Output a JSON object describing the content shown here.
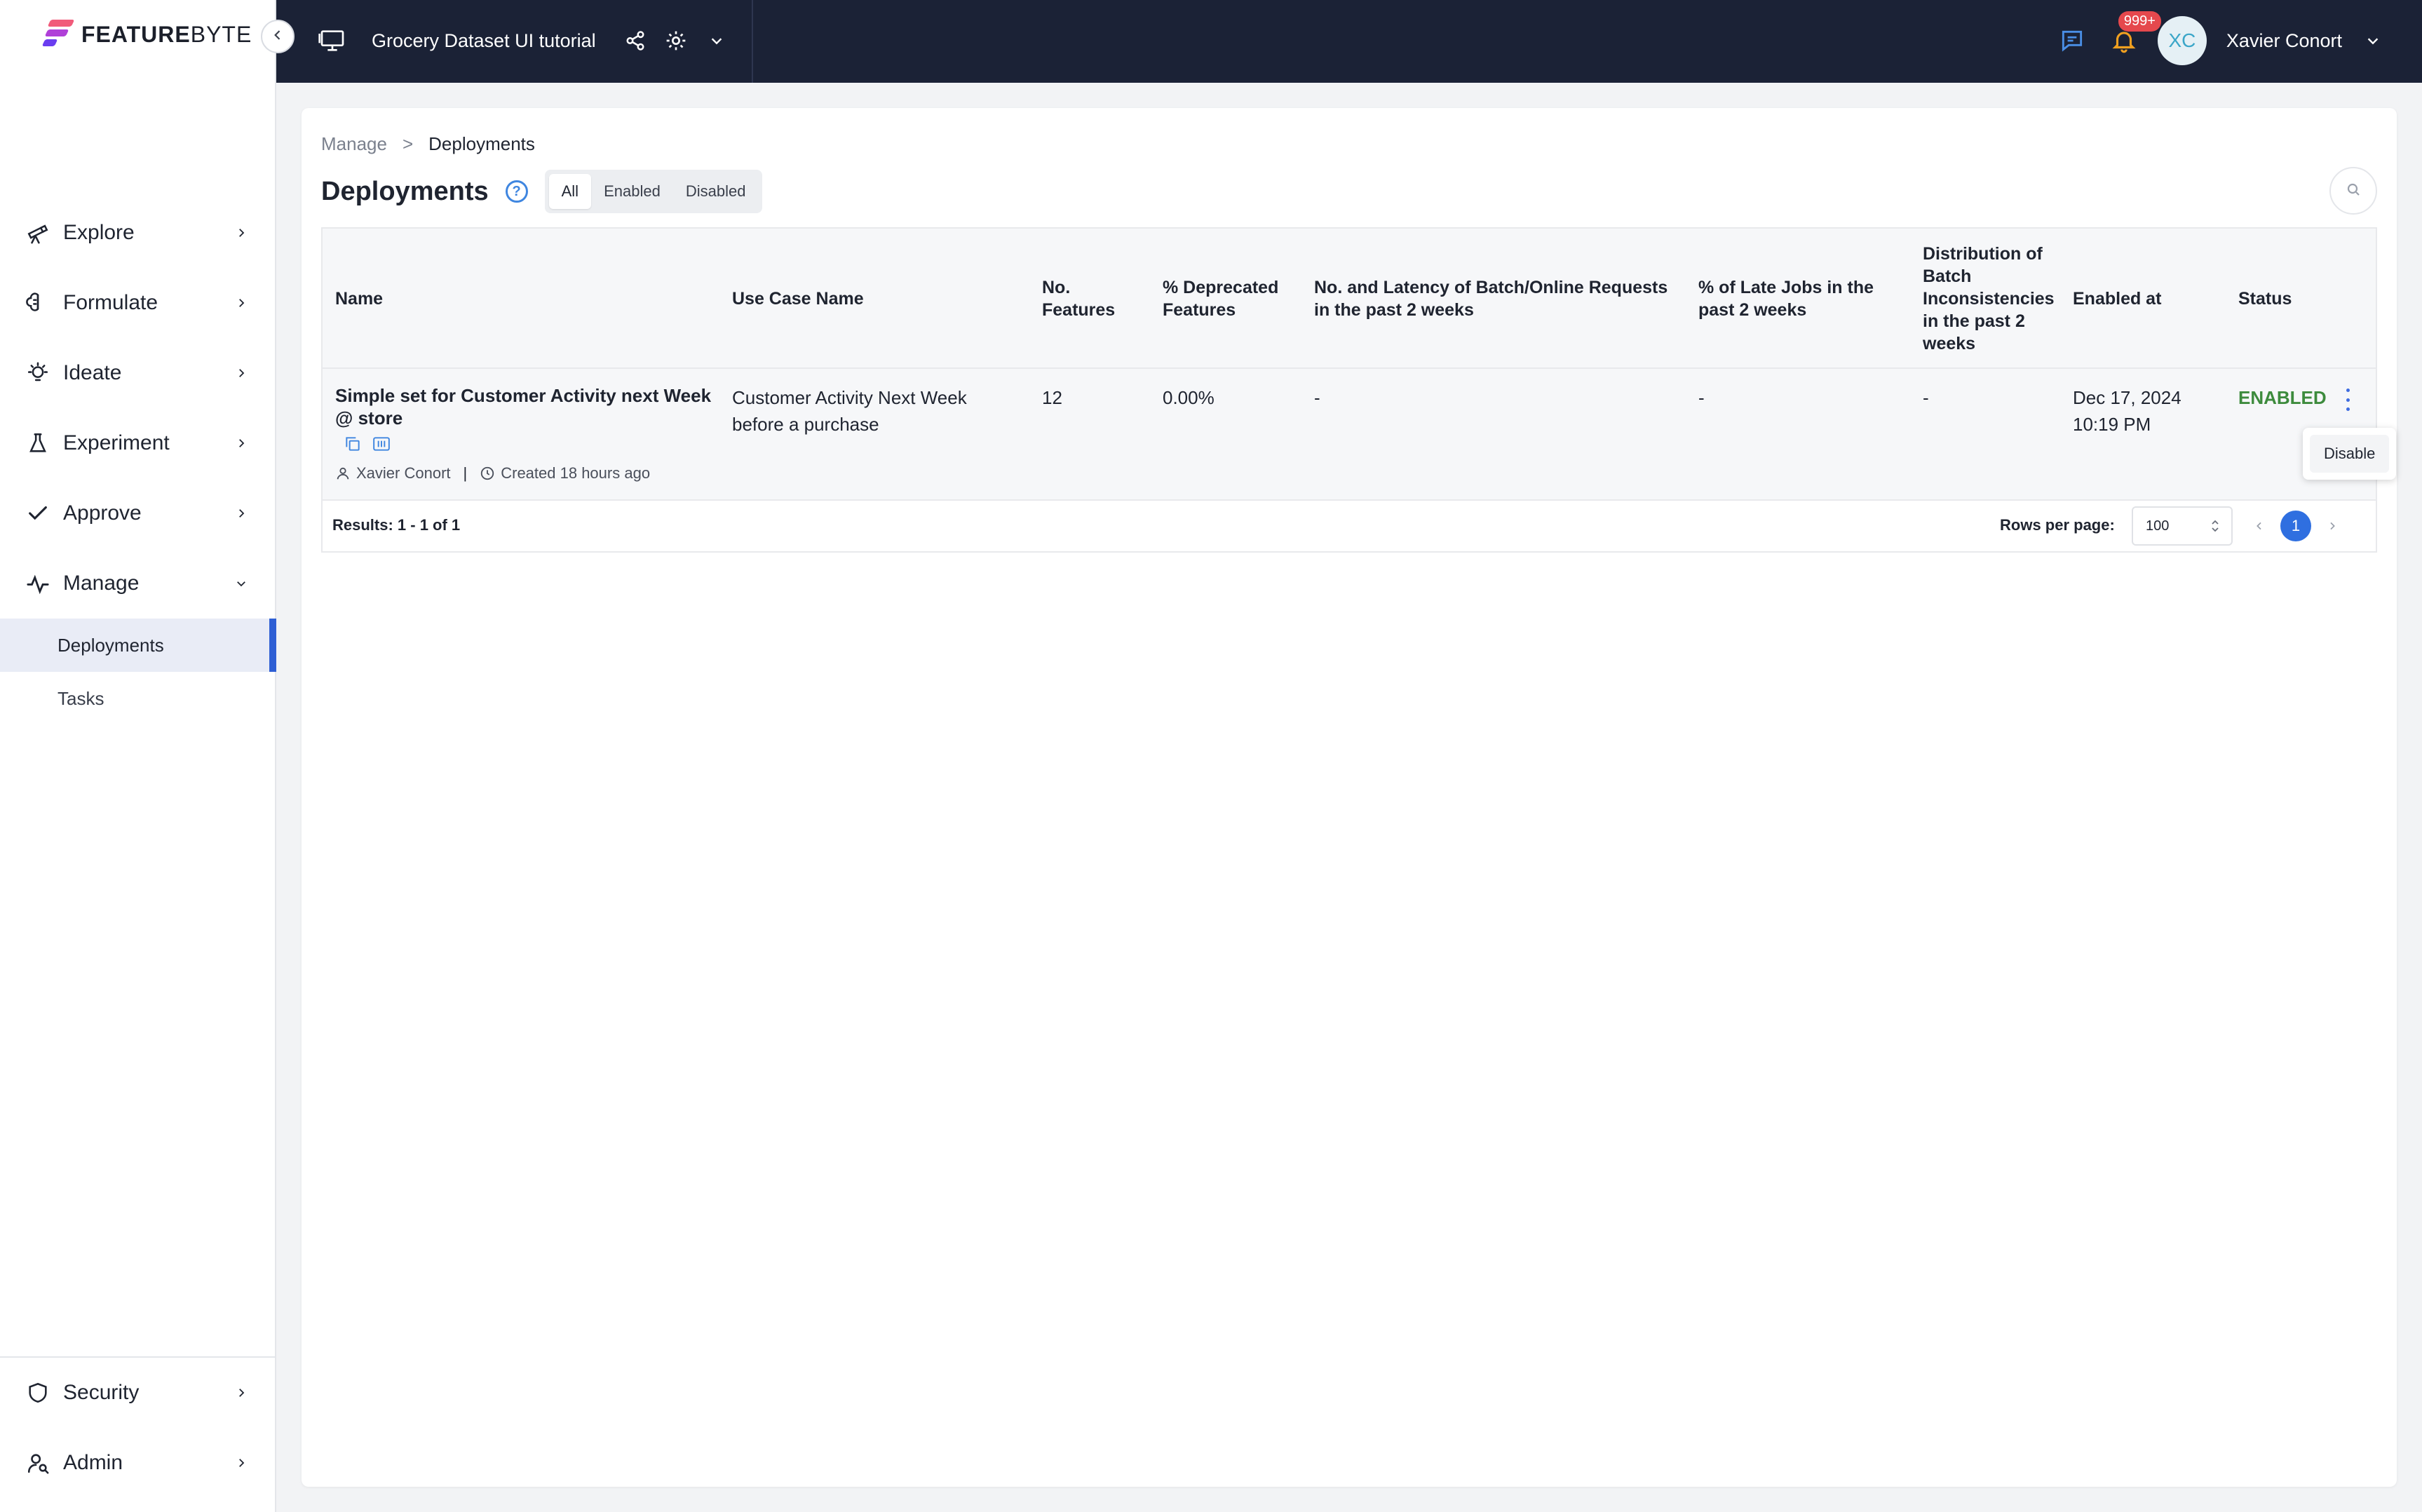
{
  "brand": {
    "word_bold": "FEATURE",
    "word_light": "BYTE"
  },
  "header": {
    "project_name": "Grocery Dataset UI tutorial",
    "notification_count": "999+",
    "avatar_initials": "XC",
    "user_name": "Xavier Conort"
  },
  "sidebar": {
    "items": [
      {
        "label": "Explore",
        "icon": "telescope-icon"
      },
      {
        "label": "Formulate",
        "icon": "brain-icon"
      },
      {
        "label": "Ideate",
        "icon": "lightbulb-icon"
      },
      {
        "label": "Experiment",
        "icon": "flask-icon"
      },
      {
        "label": "Approve",
        "icon": "check-icon"
      },
      {
        "label": "Manage",
        "icon": "activity-icon",
        "expanded": true
      }
    ],
    "sub_items": [
      {
        "label": "Deployments",
        "active": true
      },
      {
        "label": "Tasks",
        "active": false
      }
    ],
    "bottom_items": [
      {
        "label": "Security",
        "icon": "shield-icon"
      },
      {
        "label": "Admin",
        "icon": "user-search-icon"
      }
    ]
  },
  "breadcrumb": {
    "parent": "Manage",
    "separator": ">",
    "current": "Deployments"
  },
  "page": {
    "title": "Deployments",
    "help": "?",
    "filters": [
      "All",
      "Enabled",
      "Disabled"
    ],
    "active_filter": "All"
  },
  "table": {
    "columns": [
      "Name",
      "Use Case Name",
      "No. Features",
      "% Deprecated Features",
      "No. and Latency of Batch/Online Requests in the past 2 weeks",
      "% of Late Jobs in the past 2 weeks",
      "Distribution of Batch Inconsistencies in the past 2 weeks",
      "Enabled at",
      "Status"
    ],
    "rows": [
      {
        "name": "Simple set for Customer Activity next Week @ store",
        "owner": "Xavier Conort",
        "created": "Created 18 hours ago",
        "use_case": "Customer Activity Next Week before a purchase",
        "num_features": "12",
        "pct_deprecated": "0.00%",
        "requests": "-",
        "late_jobs": "-",
        "inconsistencies": "-",
        "enabled_date": "Dec 17, 2024",
        "enabled_time": "10:19 PM",
        "status": "ENABLED"
      }
    ],
    "row_menu": {
      "disable_label": "Disable"
    },
    "footer": {
      "results": "Results: 1 - 1 of 1",
      "rows_per_page_label": "Rows per page:",
      "rows_per_page_value": "100",
      "current_page": "1"
    }
  },
  "colors": {
    "accent": "#2f6fe0",
    "topbar": "#1b2236",
    "status_enabled": "#3d8b3d",
    "badge": "#e5484d"
  }
}
